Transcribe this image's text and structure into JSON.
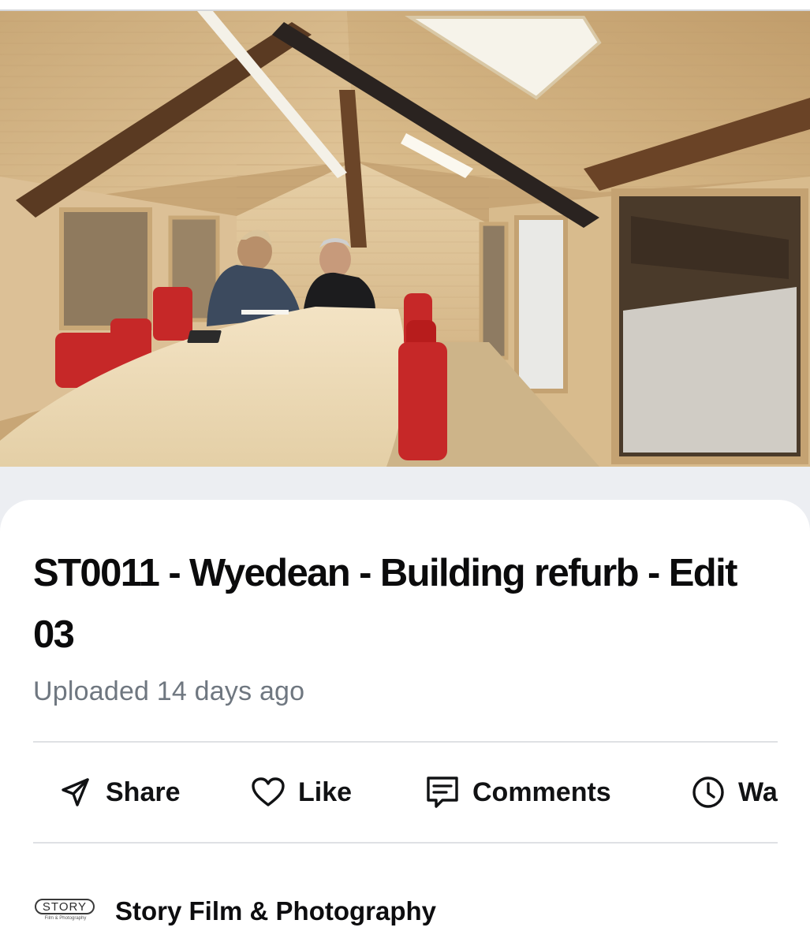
{
  "video": {
    "title": "ST0011 - Wyedean - Building refurb - Edit 03",
    "uploaded": "Uploaded 14 days ago",
    "thumbnail_icon": "meeting-room-photo"
  },
  "actions": [
    {
      "label": "Share",
      "icon": "share-arrow-icon"
    },
    {
      "label": "Like",
      "icon": "heart-icon"
    },
    {
      "label": "Comments",
      "icon": "comment-icon"
    },
    {
      "label": "Wa",
      "icon": "clock-icon"
    }
  ],
  "channel": {
    "logo_text": "STORY",
    "logo_subtext": "Film & Photography",
    "name": "Story Film & Photography"
  },
  "colors": {
    "accent_text": "#0b0b0c",
    "muted_text": "#6f7780",
    "divider": "#dfe1e4",
    "chair_red": "#c62828"
  }
}
